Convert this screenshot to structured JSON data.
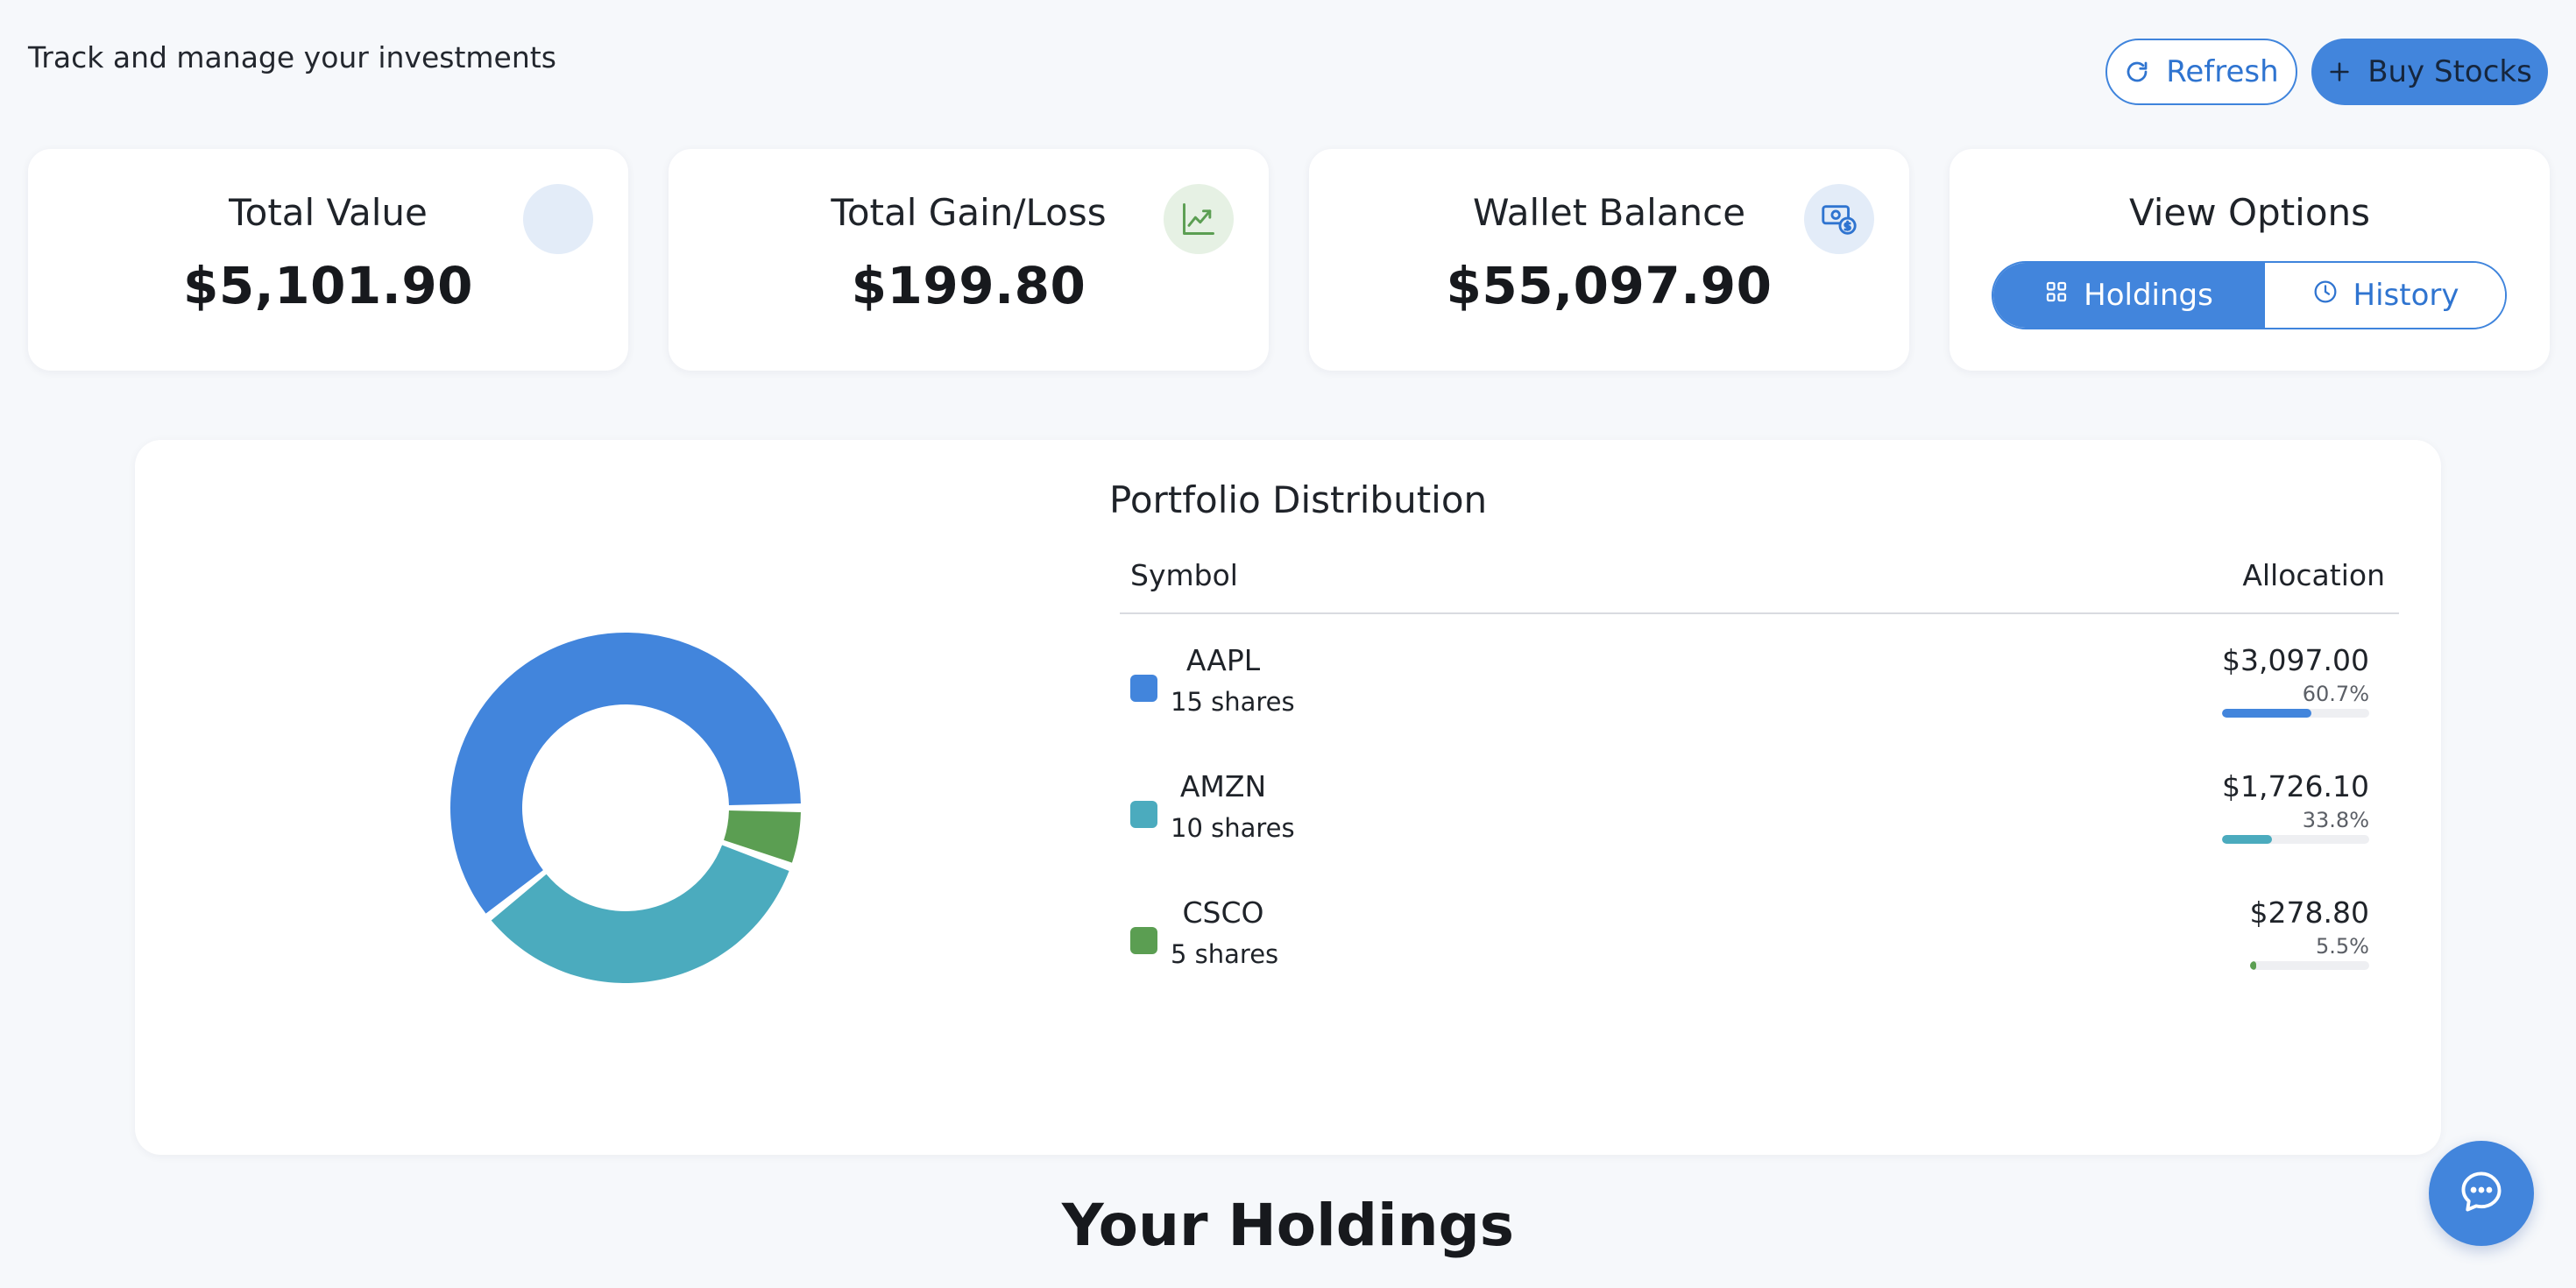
{
  "header": {
    "subtitle": "Track and manage your investments",
    "refresh_label": "Refresh",
    "buy_label": "Buy Stocks"
  },
  "cards": {
    "total_value": {
      "title": "Total Value",
      "value": "$5,101.90"
    },
    "total_gain": {
      "title": "Total Gain/Loss",
      "value": "$199.80"
    },
    "wallet": {
      "title": "Wallet Balance",
      "value": "$55,097.90"
    },
    "view_options": {
      "title": "View Options",
      "holdings_label": "Holdings",
      "history_label": "History",
      "selected": "Holdings"
    }
  },
  "distribution": {
    "title": "Portfolio Distribution",
    "col_symbol": "Symbol",
    "col_allocation": "Allocation",
    "rows": [
      {
        "symbol": "AAPL",
        "shares": "15 shares",
        "amount": "$3,097.00",
        "percent": "60.7%",
        "fraction": 0.607,
        "color": "#4285dc"
      },
      {
        "symbol": "AMZN",
        "shares": "10 shares",
        "amount": "$1,726.10",
        "percent": "33.8%",
        "fraction": 0.338,
        "color": "#4babbe"
      },
      {
        "symbol": "CSCO",
        "shares": "5 shares",
        "amount": "$278.80",
        "percent": "5.5%",
        "fraction": 0.055,
        "color": "#5b9e52"
      }
    ]
  },
  "chart_data": {
    "type": "pie",
    "categories": [
      "AAPL",
      "AMZN",
      "CSCO"
    ],
    "values": [
      3097.0,
      1726.1,
      278.8
    ],
    "colors": [
      "#4285dc",
      "#4babbe",
      "#5b9e52"
    ],
    "title": ""
  },
  "holdings": {
    "title": "Your Holdings"
  },
  "colors": {
    "accent": "#4285dc",
    "page_bg": "#f6f8fb"
  },
  "icons": {
    "refresh": "refresh-icon",
    "buy": "plus-icon",
    "gain": "trending-up-icon",
    "wallet": "wallet-dollar-icon",
    "holdings": "grid-icon",
    "history": "clock-icon",
    "chat": "chat-icon"
  }
}
